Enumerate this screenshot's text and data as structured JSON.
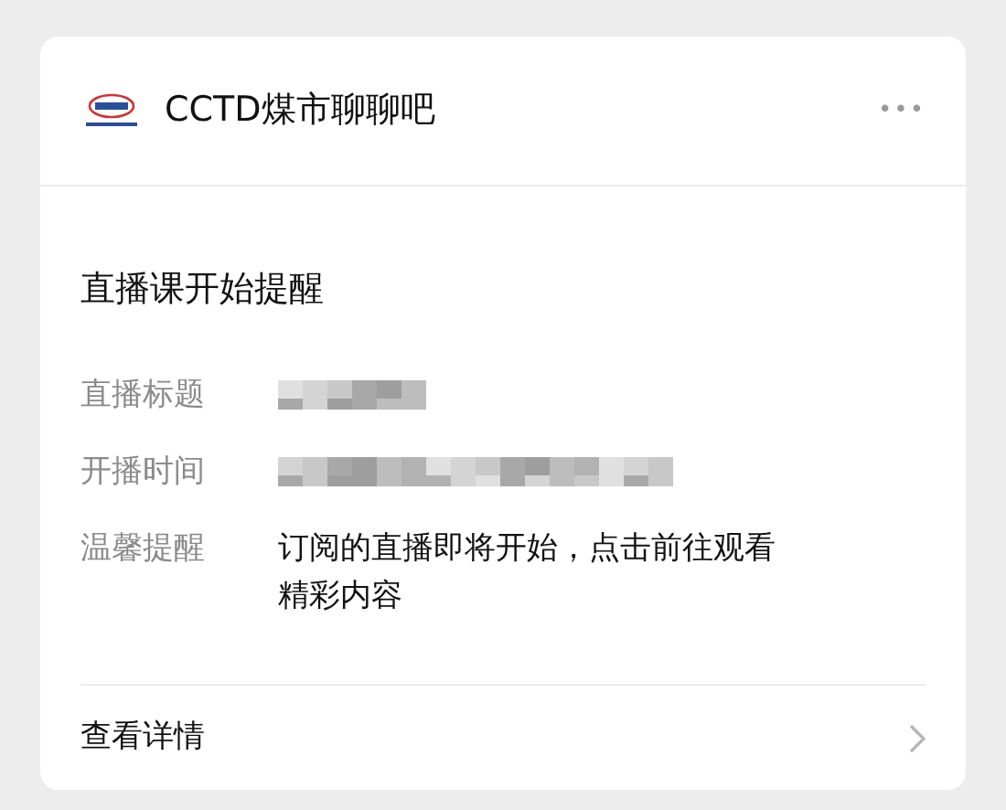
{
  "account": {
    "name": "CCTD煤市聊聊吧",
    "more": "•••"
  },
  "title": "直播课开始提醒",
  "fields": [
    {
      "label": "直播标题",
      "value": {
        "kind": "pixelated"
      }
    },
    {
      "label": "开播时间",
      "value": {
        "kind": "pixelated"
      }
    },
    {
      "label": "温馨提醒",
      "value": {
        "kind": "text",
        "text": "订阅的直播即将开始，点击前往观看精彩内容"
      }
    }
  ],
  "footer": {
    "link": "查看详情"
  }
}
